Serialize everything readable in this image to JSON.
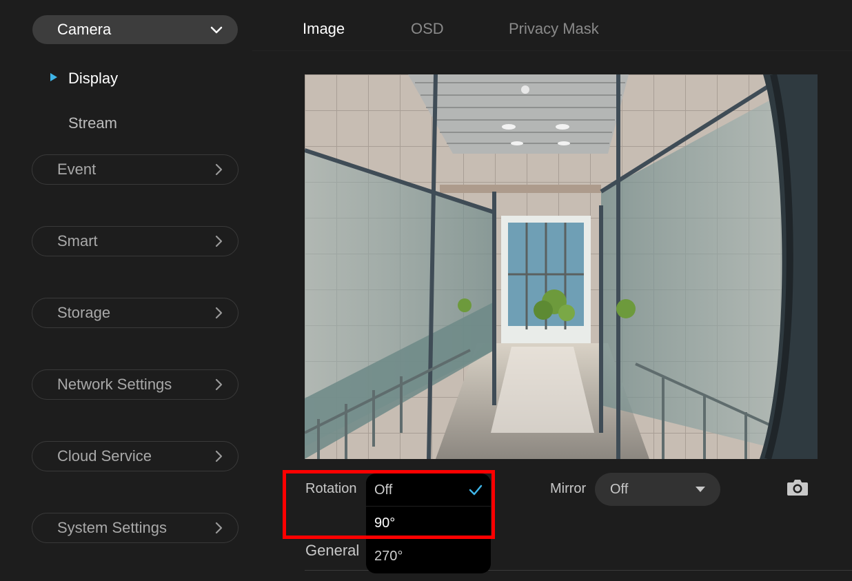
{
  "sidebar": {
    "camera_label": "Camera",
    "sub_items": [
      "Display",
      "Stream"
    ],
    "menu": [
      "Event",
      "Smart",
      "Storage",
      "Network Settings",
      "Cloud Service",
      "System Settings"
    ]
  },
  "tabs": [
    "Image",
    "OSD",
    "Privacy Mask"
  ],
  "controls": {
    "rotation_label": "Rotation",
    "rotation_options": [
      "Off",
      "90°",
      "270°"
    ],
    "rotation_selected": "Off",
    "mirror_label": "Mirror",
    "mirror_value": "Off",
    "general_title": "General"
  },
  "icons": {
    "camera_dropdown": "chevron-down-icon",
    "menu_arrow": "chevron-right-icon",
    "selected": "checkmark-icon",
    "snapshot": "camera-snapshot-icon",
    "mirror_dropdown": "caret-down-icon"
  },
  "colors": {
    "accent": "#3fb5e8",
    "highlight": "#ff0000",
    "background": "#1d1d1d"
  }
}
